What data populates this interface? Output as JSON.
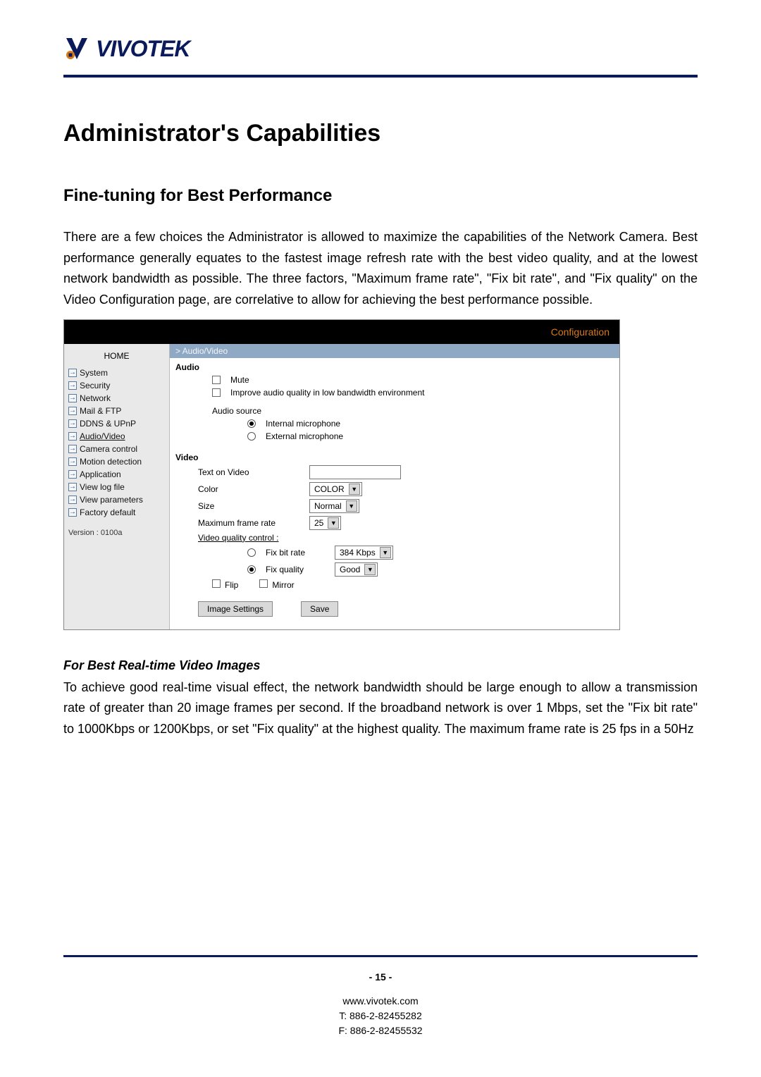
{
  "brand": "VIVOTEK",
  "h1": "Administrator's Capabilities",
  "h2": "Fine-tuning for Best Performance",
  "para1": "There are a few choices the Administrator is allowed to maximize the capabilities of the Network Camera.  Best performance generally equates to the fastest image refresh rate with the best video quality, and at the lowest network bandwidth as possible. The three factors, \"Maximum frame rate\", \"Fix bit rate\", and \"Fix quality\" on the Video Configuration page, are correlative to allow for achieving the best performance possible.",
  "h3": "For Best Real-time Video Images",
  "para2": "To achieve good real-time visual effect, the network bandwidth should be large enough to allow a transmission rate of greater than 20 image frames per second.  If the broadband network is over 1 Mbps, set the \"Fix bit rate\" to 1000Kbps or 1200Kbps, or set \"Fix quality\" at the highest quality. The maximum frame rate is 25 fps in a 50Hz",
  "page": "- 15 -",
  "footer": {
    "site": "www.vivotek.com",
    "tel": "T: 886-2-82455282",
    "fax": "F: 886-2-82455532"
  },
  "config": {
    "title": "Configuration",
    "home": "HOME",
    "side": [
      "System",
      "Security",
      "Network",
      "Mail & FTP",
      "DDNS & UPnP",
      "Audio/Video",
      "Camera control",
      "Motion detection",
      "Application",
      "View log file",
      "View parameters",
      "Factory default"
    ],
    "version": "Version : 0100a",
    "breadcrumb": "> Audio/Video",
    "audio_hdr": "Audio",
    "mute": "Mute",
    "improve": "Improve audio quality in low bandwidth environment",
    "audio_source": "Audio source",
    "int_mic": "Internal microphone",
    "ext_mic": "External microphone",
    "video_hdr": "Video",
    "text_on_video": "Text on Video",
    "color": "Color",
    "color_val": "COLOR",
    "size": "Size",
    "size_val": "Normal",
    "max_frame": "Maximum frame rate",
    "max_frame_val": "25",
    "vqc": "Video quality control :",
    "fix_bit": "Fix bit rate",
    "fix_bit_val": "384 Kbps",
    "fix_quality": "Fix quality",
    "fix_quality_val": "Good",
    "flip": "Flip",
    "mirror": "Mirror",
    "btn_image": "Image Settings",
    "btn_save": "Save"
  }
}
